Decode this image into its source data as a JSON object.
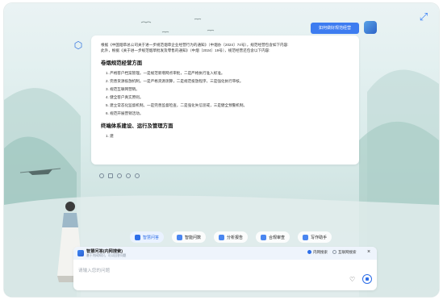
{
  "header": {
    "ask_button": "如何做好规范经营",
    "expand_icon": "expand-icon"
  },
  "answer": {
    "intro1": "根据《中国烟草总公司关于进一步规范烟草企业经营行为的通知》（中烟办〔2024〕74号），规范经营包含如下内容:",
    "intro2": "此外，根据《关于进一步规范烟草批发及零售的通知》（中烟〔2024〕19号），规范经营还包含以下内容:",
    "section1_title": "卷烟规范经营方面",
    "section1_items": [
      "1. 严格客户档案管理。一是规范新增网点审批，二是严格执行准入标准。",
      "2. 完善货源投放机制。一是严格货源测算，二是规范投放程序，三是强化执行审核。",
      "3. 规范互联网营销。",
      "4. 健全客户真实原则。",
      "5. 建立常态化监督机制。一是完善监督检查，二是强化失信惩戒，三是健全预警机制。",
      "6. 规范开展营销活动。"
    ],
    "section2_title": "终端体系建设、运行及管理方面",
    "section2_items": [
      "1. 建"
    ]
  },
  "tabs": [
    {
      "label": "智慧问答",
      "icon": "chat-icon",
      "active": true
    },
    {
      "label": "智能问数",
      "icon": "chart-icon",
      "active": false
    },
    {
      "label": "分析报告",
      "icon": "report-icon",
      "active": false
    },
    {
      "label": "合规审查",
      "icon": "audit-icon",
      "active": false
    },
    {
      "label": "写作助手",
      "icon": "pen-icon",
      "active": false
    }
  ],
  "input_panel": {
    "mode_title": "智慧问答(内网搜索)",
    "mode_subtitle": "基于内网知识，可以回答问题",
    "option_internal": "内网搜索",
    "option_internet": "互联网搜索",
    "placeholder": "请输入您的问题"
  },
  "colors": {
    "accent": "#2d6ee8",
    "ask_button_bg": "#3d7cf0",
    "background": "#dbeceb"
  }
}
